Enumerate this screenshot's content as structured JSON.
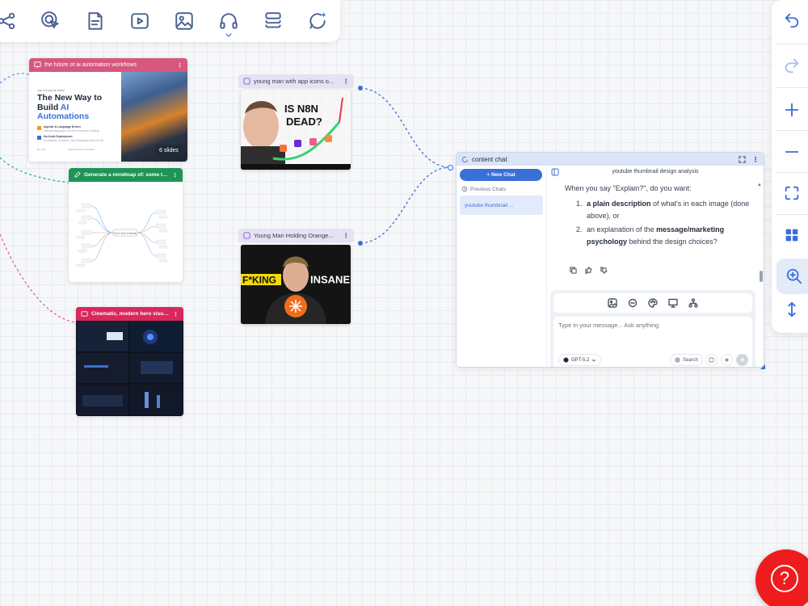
{
  "toolbar": {
    "tools": [
      {
        "icon": "share-icon"
      },
      {
        "icon": "target-click-icon"
      },
      {
        "icon": "document-icon"
      },
      {
        "icon": "video-play-icon"
      },
      {
        "icon": "image-icon"
      },
      {
        "icon": "headphones-icon"
      },
      {
        "icon": "layers-icon"
      },
      {
        "icon": "chat-sparkle-icon"
      }
    ]
  },
  "rail": {
    "items": [
      "undo-icon",
      "redo-icon",
      "zoom-in-icon",
      "zoom-out-icon",
      "fit-screen-icon",
      "grid-icon",
      "zoom-search-icon",
      "vertical-resize-icon"
    ]
  },
  "slides_node": {
    "header": "the future of ai automation workflows",
    "eyebrow": "THE FUTURE OF WORK",
    "title_line1": "The New Way to",
    "title_line2_plain": "Build ",
    "title_line2_accent": "AI",
    "title_line3": "Automations",
    "bullet1_title": "Agentic & Language Driven",
    "bullet1_sub": "Natural language & AI-first workflow building",
    "bullet2_title": "No-Code Deployment",
    "bullet2_sub": "Accessible, scalable, and integrated tools for all",
    "footer_left": "BY: AIR",
    "footer_mid": "INNOVATION SYSTEMS",
    "badge": "6 slides"
  },
  "mindmap_node": {
    "header": "Generate a mindmap of: some topic",
    "center_label": "Some topic mindmap"
  },
  "hero_node": {
    "header": "Cinematic, modern hero visual..."
  },
  "thumb1": {
    "header": "young man with app icons o...",
    "title_line1": "IS N8N",
    "title_line2": "DEAD?"
  },
  "thumb2": {
    "header": "Young Man Holding Orange...",
    "text_left": "F*KING",
    "text_right": "INSANE"
  },
  "chat": {
    "header": "content chat",
    "new_chat": "+ New Chat",
    "previous_label": "Previous Chats",
    "previous_item": "youtube thumbnail ...",
    "conversation_title": "youtube thumbnail design analysis",
    "intro": "When you say \"Explain?\", do you want:",
    "opt1_bold": "a plain description",
    "opt1_rest": " of what's in each image (done above), or",
    "opt2_plain": "an explanation of the ",
    "opt2_bold": "message/marketing psychology",
    "opt2_rest": " behind the design choices?",
    "input_placeholder": "Type in your message... Ask anything",
    "model": "GPT-5.2",
    "search": "Search"
  },
  "colors": {
    "accent": "#3b6fd8",
    "slides_header": "#d6587f",
    "mindmap_header": "#1e9455",
    "hero_header": "#d9285c",
    "help": "#ee1c1c"
  }
}
